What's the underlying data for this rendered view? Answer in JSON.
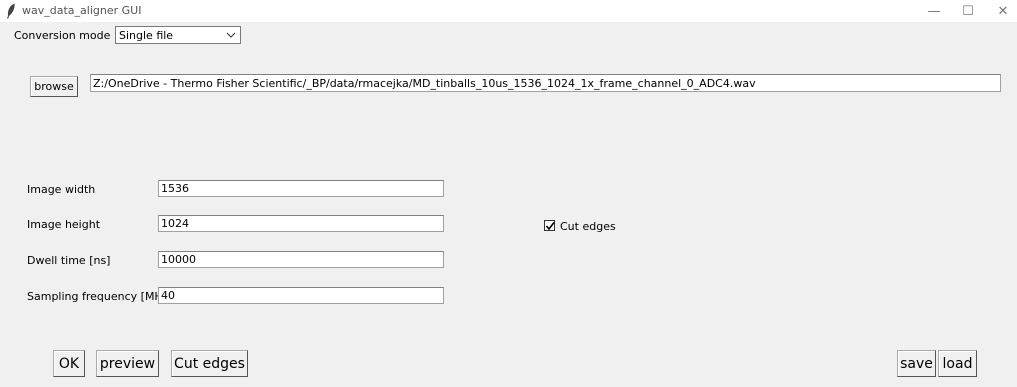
{
  "window": {
    "title": "wav_data_aligner GUI",
    "icon": "feather-icon",
    "minimize_glyph": "—",
    "maximize_glyph": "☐",
    "close_glyph": "✕"
  },
  "conversion": {
    "label": "Conversion mode",
    "selected": "Single file",
    "icon": "chevron-down-icon"
  },
  "browse": {
    "button_label": "browse",
    "path": "Z:/OneDrive - Thermo Fisher Scientific/_BP/data/rmacejka/MD_tinballs_10us_1536_1024_1x_frame_channel_0_ADC4.wav"
  },
  "fields": {
    "image_width": {
      "label": "Image width",
      "value": "1536"
    },
    "image_height": {
      "label": "Image height",
      "value": "1024"
    },
    "dwell_time": {
      "label": "Dwell time [ns]",
      "value": "10000"
    },
    "sampling_frequency": {
      "label": "Sampling frequency [MHz]",
      "value": "40"
    }
  },
  "cut_edges_option": {
    "label": "Cut edges",
    "checked": true
  },
  "buttons": {
    "ok": "OK",
    "preview": "preview",
    "cut_edges": "Cut edges",
    "save": "save",
    "load": "load"
  }
}
